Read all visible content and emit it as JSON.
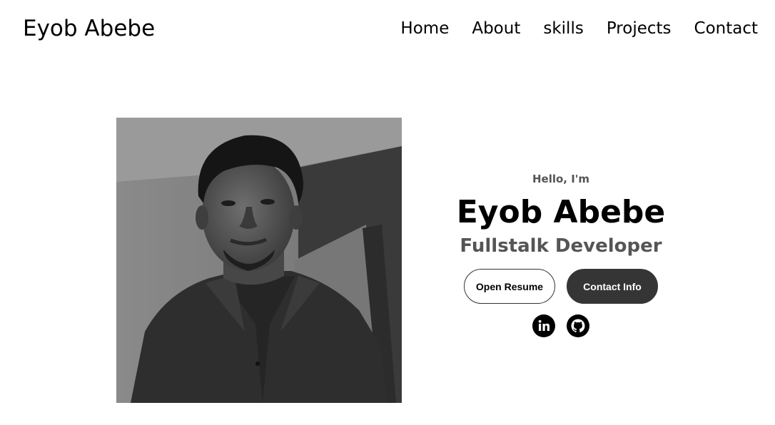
{
  "header": {
    "logo": "Eyob Abebe",
    "nav": [
      {
        "label": "Home"
      },
      {
        "label": "About"
      },
      {
        "label": "skills"
      },
      {
        "label": "Projects"
      },
      {
        "label": "Contact"
      }
    ]
  },
  "profile": {
    "photo_icon": "profile-photo"
  },
  "hero": {
    "greeting": "Hello, I'm",
    "name": "Eyob Abebe",
    "title": "Fullstalk Developer",
    "buttons": {
      "resume": "Open Resume",
      "contact": "Contact Info"
    },
    "socials": [
      {
        "icon": "linkedin-icon"
      },
      {
        "icon": "github-icon"
      }
    ]
  },
  "colors": {
    "primary_text": "#000000",
    "secondary_text": "#555555",
    "dark_button": "#353535",
    "background": "#ffffff"
  }
}
